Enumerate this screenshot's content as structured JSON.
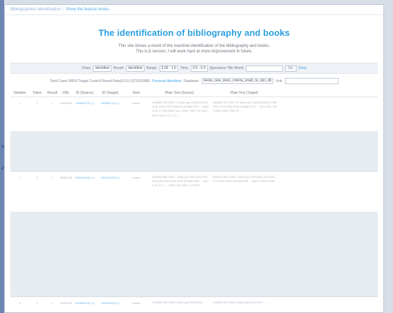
{
  "topbar": {
    "crumb": "Bibliographies Identification",
    "link": "Show the feature books"
  },
  "title": "The identification of bibliography and books",
  "desc": {
    "line1": "This site shows a result of the machine identification of the bibliography and books.",
    "line2": "This is β version, I will work hard at more improvement in future."
  },
  "controls": {
    "class_label": "Class:",
    "class_value": "Identified",
    "result_label": "Result:",
    "result_value": "Identified",
    "range_label": "Range:",
    "range_value": "0.00 - 1.0",
    "time_label": "Time:",
    "time_value": "0.0 - 0.0",
    "keyword_label": "(Ignorance Title Word)",
    "search_placeholder": "",
    "btn_go": "Go",
    "link_clear": "Clear"
  },
  "stats": {
    "text": "Total Count:39816  Target Count:0  Result Rate(0.01):13733/26880",
    "link_name": "Personal Identifiers",
    "db_label": "Database:",
    "db_value": "books_new_deno_criteria_small_ns_sbn_db",
    "unit_label": "Unit:"
  },
  "columns": [
    "Number",
    "Token",
    "Result",
    "DRL",
    "ID (Source)",
    "ID (Target)",
    "Kind",
    "Plain Text (Source)",
    "Plain Text (Target)"
  ],
  "rows": [
    {
      "number": "1",
      "token": "1",
      "result": "1",
      "drl": "03406 40",
      "id_source": "4406857370_n",
      "id_target": "4406857370_p",
      "kind": "books",
      "src": "4406857370 2001 13 18cm jpn 20052100 ND2 [A] 1996 2470 2090 50 4406857370 ... 1998 1001 2 2000 MAR 18 p 1996 / 1997 2 5 1001 0007 0099 1 8 2 7 5 ...",
      "tgt": "4406857370 2001 13 18cm jpn 20052100 ND2 1996 1997 2470 2090 2060 4406857370 ... 2001 NDL 1001 0099 2000 1999 10 ..."
    },
    {
      "number": "2",
      "token": "1",
      "result": "1",
      "drl": "03406 38",
      "id_source": "4344001996_m",
      "id_target": "4344001996_p",
      "kind": "books",
      "src": "4344001996 2000 1 20cm jpn 20021200 ND2 0010 [A] 1999 2400 2000 4344001996 ... 2000 10 1 2 1 ... 1998 1001 0007 2 2 0099 ...",
      "tgt": "4344001996 2000 1 20cm jpn 20021200 2000 NDL 1 10 2400 2000 4344001996 ... 2001 2 0099 1998 ..."
    },
    {
      "number": "3",
      "token": "1",
      "result": "1",
      "drl": "03406 40",
      "id_source": "4106057043_m",
      "id_target": "4106057043_p",
      "kind": "books",
      "src": "4106057043 2002.5 48cm jpn 20040400 ...",
      "tgt": "4106057043 2002.5 48cm jpn 2004 2007 ..."
    }
  ]
}
